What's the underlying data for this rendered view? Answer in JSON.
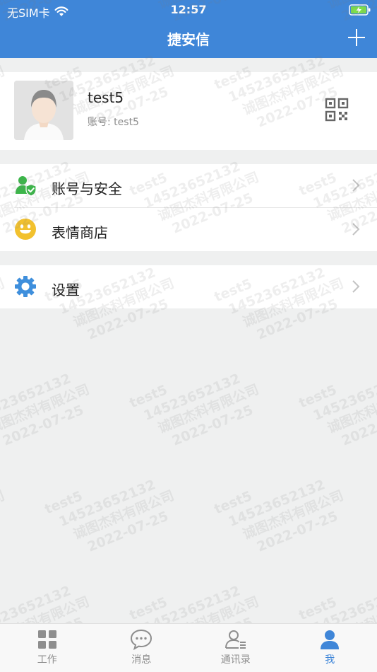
{
  "status_bar": {
    "carrier": "无SIM卡",
    "time": "12:57"
  },
  "nav": {
    "title": "捷安信",
    "add_icon": "plus-icon"
  },
  "profile": {
    "name": "test5",
    "account": "账号: test5",
    "qr_icon": "qr-code-icon"
  },
  "menu": [
    {
      "label": "账号与安全",
      "icon": "user-shield-icon"
    },
    {
      "label": "表情商店",
      "icon": "smiley-icon"
    },
    {
      "label": "设置",
      "icon": "gear-icon"
    }
  ],
  "watermark": {
    "user": "test5",
    "phone": "14523652132",
    "company": "诚图杰科有限公司",
    "date": "2022-07-25"
  },
  "tabbar": [
    {
      "label": "工作",
      "icon": "grid-icon",
      "active": false
    },
    {
      "label": "消息",
      "icon": "chat-bubble-icon",
      "active": false
    },
    {
      "label": "通讯录",
      "icon": "contacts-icon",
      "active": false
    },
    {
      "label": "我",
      "icon": "person-icon",
      "active": true
    }
  ],
  "colors": {
    "brand": "#3f86d8",
    "background": "#eff0f0",
    "accent_green": "#3cb54a",
    "accent_yellow": "#f2c12e"
  }
}
